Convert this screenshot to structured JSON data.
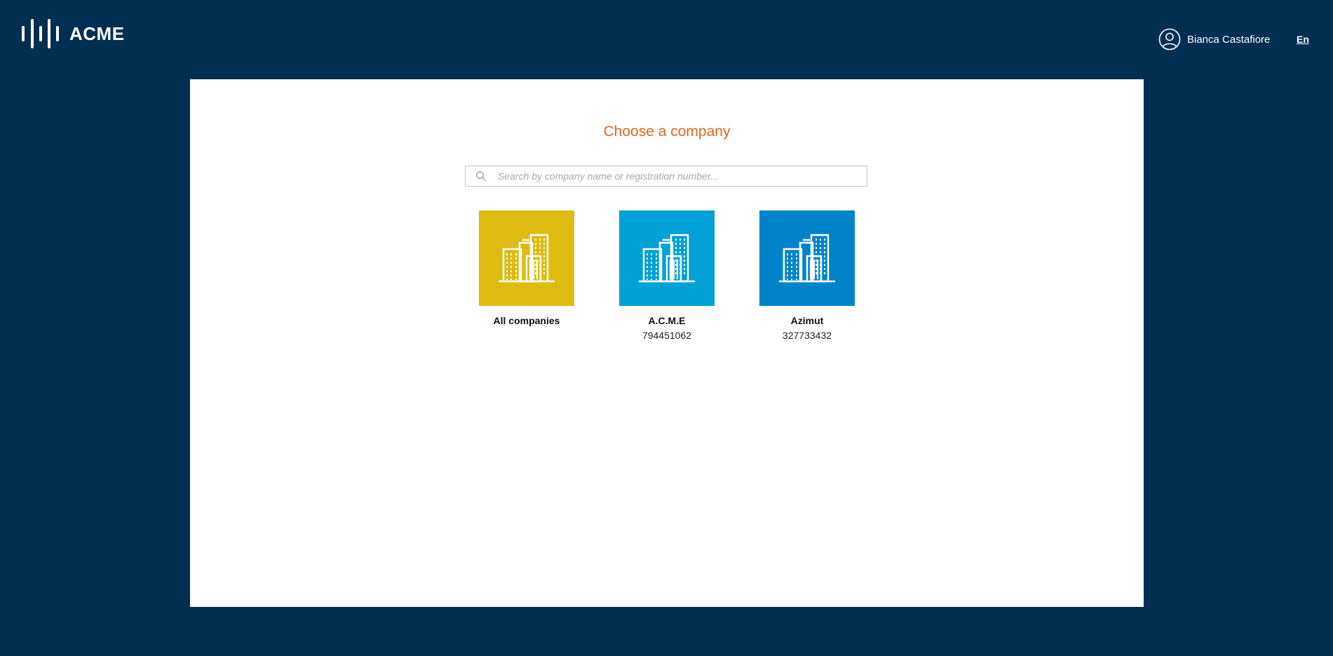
{
  "header": {
    "brand": "ACME",
    "user_name": "Bianca Castafiore",
    "language": "En"
  },
  "main": {
    "title": "Choose a company",
    "search_placeholder": "Search by company name or registration number...",
    "companies": [
      {
        "name": "All companies",
        "registration": "",
        "color": "#dfbb11",
        "icon": "buildings-icon"
      },
      {
        "name": "A.C.M.E",
        "registration": "794451062",
        "color": "#00a1d6",
        "icon": "buildings-icon"
      },
      {
        "name": "Azimut",
        "registration": "327733432",
        "color": "#0083ca",
        "icon": "buildings-icon"
      }
    ]
  },
  "colors": {
    "background": "#002f52",
    "title_accent": "#e2671b"
  }
}
